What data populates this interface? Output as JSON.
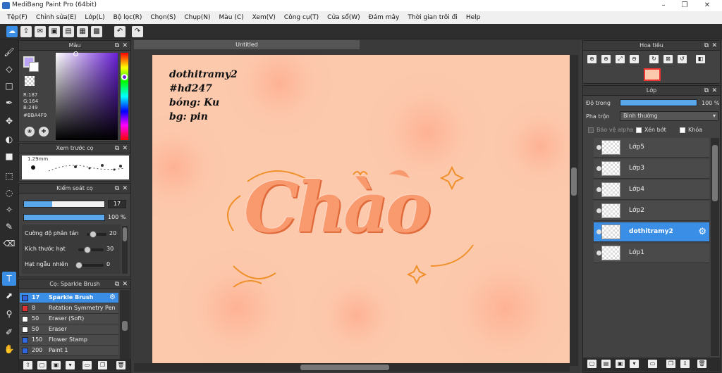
{
  "window": {
    "title": "MediBang Paint Pro (64bit)",
    "minimize": "–",
    "maximize": "❐",
    "close": "✕"
  },
  "menu": [
    "Tệp(F)",
    "Chỉnh sửa(E)",
    "Lớp(L)",
    "Bộ lọc(R)",
    "Chọn(S)",
    "Chụp(N)",
    "Màu (C)",
    "Xem(V)",
    "Công cụ(T)",
    "Cửa sổ(W)",
    "Đám mây",
    "Thời gian trôi đi",
    "Help"
  ],
  "color_panel": {
    "title": "Màu",
    "r": "R:187",
    "g": "G:164",
    "b": "B:249",
    "hex": "#BBA4F9",
    "fg_color": "#bba4f9"
  },
  "brush_preview": {
    "title": "Xem trước cọ",
    "size": "1.29mm"
  },
  "brush_control": {
    "title": "Kiểm soát cọ",
    "size_value": "17",
    "size_fill": 0.35,
    "opacity_value": "100 %",
    "opacity_fill": 1.0,
    "params": [
      {
        "label": "Cường độ phân tán",
        "value": "20",
        "level": 0.2
      },
      {
        "label": "Kích thước hạt",
        "value": "30",
        "level": 0.3
      },
      {
        "label": "Hạt ngẫu nhiên",
        "value": "0",
        "level": 0.0
      }
    ]
  },
  "brush_list": {
    "title": "Cọ: Sparkle Brush",
    "items": [
      {
        "size": "17",
        "name": "Sparkle Brush",
        "color": "#3366dd",
        "selected": true
      },
      {
        "size": "8",
        "name": "Rotation Symmetry Pen",
        "color": "#dd3333",
        "selected": false
      },
      {
        "size": "50",
        "name": "Eraser (Soft)",
        "color": "#ffffff",
        "selected": false
      },
      {
        "size": "50",
        "name": "Eraser",
        "color": "#ffffff",
        "selected": false
      },
      {
        "size": "150",
        "name": "Flower Stamp",
        "color": "#3366dd",
        "selected": false
      },
      {
        "size": "200",
        "name": "Paint 1",
        "color": "#3366dd",
        "selected": false
      }
    ]
  },
  "document": {
    "tab": "Untitled",
    "notes": [
      "dothitramy2",
      "#hđ247",
      "bóng: Ku",
      "bg: pin"
    ],
    "art_text": "Chào",
    "bg_color": "#fcc9ad"
  },
  "navigator": {
    "title": "Hoa tiêu"
  },
  "layers": {
    "title": "Lớp",
    "opacity_label": "Độ trong",
    "opacity_value": "100 %",
    "blend_label": "Pha trộn",
    "blend_value": "Bình thường",
    "protect_alpha": "Bảo vệ alpha",
    "clipping": "Xén bớt",
    "lock": "Khóa",
    "items": [
      {
        "name": "Lớp5",
        "selected": false
      },
      {
        "name": "Lớp3",
        "selected": false
      },
      {
        "name": "Lớp4",
        "selected": false
      },
      {
        "name": "Lớp2",
        "selected": false
      },
      {
        "name": "dothitramy2",
        "selected": true
      },
      {
        "name": "Lớp1",
        "selected": false
      }
    ]
  },
  "icons": {
    "toolbar": [
      "cloud-icon",
      "share-icon",
      "comment-icon",
      "save-icon",
      "document-icon",
      "grid-icon",
      "tile-icon",
      "undo-icon",
      "redo-icon"
    ],
    "tools": [
      "brush-icon",
      "eraser-icon",
      "rectangle-icon",
      "pen-icon",
      "move-icon",
      "bucket-icon",
      "fill-rect-icon",
      "select-rect-icon",
      "lasso-icon",
      "magic-wand-icon",
      "select-pen-icon",
      "select-eraser-icon",
      "text-icon",
      "operation-icon",
      "eyedropper-icon",
      "hand-icon"
    ]
  }
}
